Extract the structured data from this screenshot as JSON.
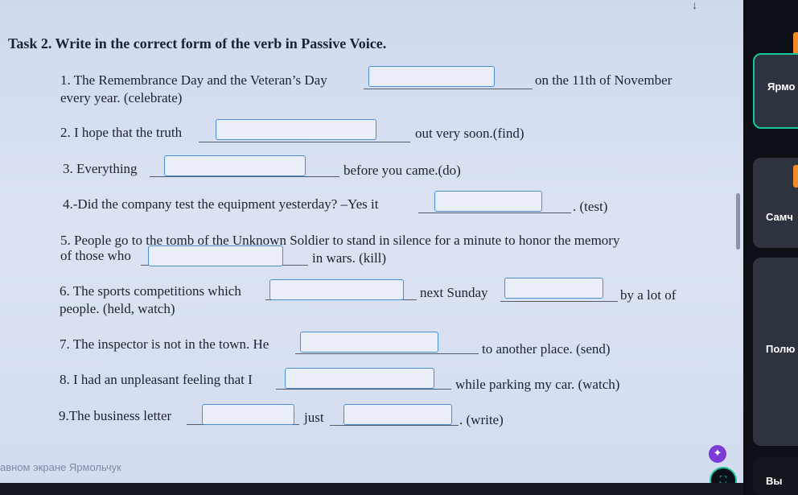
{
  "task_title": "Task 2. Write in the correct form of the verb in Passive Voice.",
  "items": [
    {
      "line1a": "1. The Remembrance Day and the Veteran’s Day",
      "line1b": "on the 11th of November",
      "line2": "every year. (celebrate)"
    },
    {
      "a": "2. I hope that the truth",
      "b": "out very soon.(find)"
    },
    {
      "a": "3. Everything",
      "b": "before you came.(do)"
    },
    {
      "a": "4.-Did the company test the equipment yesterday? –Yes it",
      "b": ". (test)"
    },
    {
      "line1": "5. People go to the tomb of the Unknown Soldier to stand in silence for a minute to honor the memory",
      "line2a": "of those who",
      "line2b": "in wars. (kill)"
    },
    {
      "line1a": "6. The sports competitions which",
      "line1b": "next Sunday",
      "line1c": "by a lot of",
      "line2": "people. (held, watch)"
    },
    {
      "a": "7. The inspector is not in the town. He",
      "b": "to another place. (send)"
    },
    {
      "a": "8. I had an unpleasant feeling that I",
      "b": "while parking my car. (watch)"
    },
    {
      "a": "9.The business letter",
      "b": "just",
      "c": ". (write)"
    }
  ],
  "watermark": "авном экране Ярмольчук",
  "sidebar": {
    "participants": [
      {
        "name": "Ярмо",
        "active": true
      },
      {
        "name": "Самч",
        "active": false
      },
      {
        "name": "Полю",
        "active": false
      },
      {
        "name": "Вы",
        "active": false
      }
    ]
  },
  "colors": {
    "accent": "#14c8a0",
    "blank_border": "#4a8fd6"
  }
}
